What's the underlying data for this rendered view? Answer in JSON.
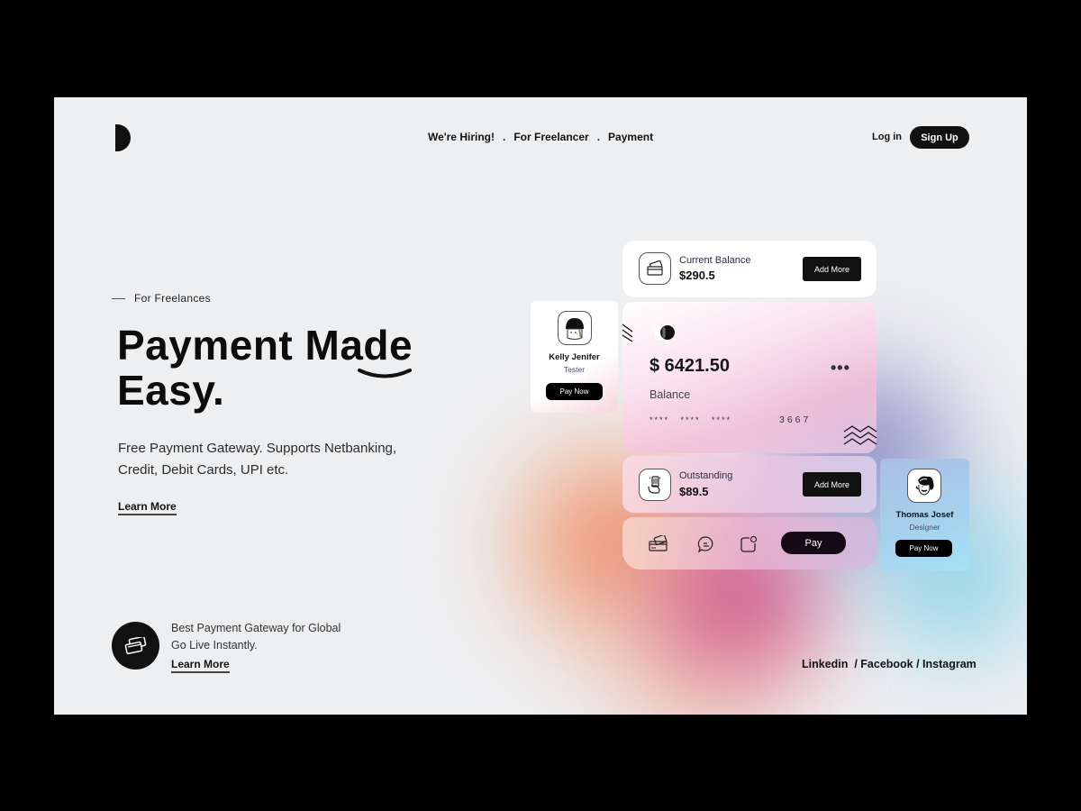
{
  "brand": {
    "logo_icon": "half-circle-logo"
  },
  "nav": {
    "items": [
      {
        "label": "We're Hiring!"
      },
      {
        "label": "For Freelancer"
      },
      {
        "label": "Payment"
      }
    ],
    "separator": ".",
    "login_label": "Log in",
    "signup_label": "Sign Up"
  },
  "hero": {
    "eyebrow": "For Freelances",
    "headline_line1": "Payment Made",
    "headline_line2": "Easy.",
    "description": "Free Payment Gateway. Supports Netbanking, Credit, Debit Cards, UPI etc.",
    "learn_more": "Learn More"
  },
  "promo": {
    "icon": "credit-cards-icon",
    "line1": "Best Payment Gateway for Global",
    "line2": "Go Live Instantly.",
    "learn_more": "Learn More"
  },
  "social": {
    "text": "Linkedin  / Facebook / Instagram"
  },
  "wallet": {
    "current_balance": {
      "label": "Current Balance",
      "value": "$290.5",
      "button": "Add More",
      "icon": "wallet-card-icon"
    },
    "main_card": {
      "amount": "$ 6421.50",
      "label": "Balance",
      "masked": "**** **** ****",
      "last4": "3667",
      "menu": "•••"
    },
    "outstanding": {
      "label": "Outstanding",
      "value": "$89.5",
      "button": "Add More",
      "icon": "hand-card-icon"
    },
    "actions": {
      "icons": [
        "card-icon",
        "chat-icon",
        "notification-icon"
      ],
      "pay_label": "Pay"
    }
  },
  "contacts": [
    {
      "name": "Kelly Jenifer",
      "role": "Tester",
      "button": "Pay Now"
    },
    {
      "name": "Thomas Josef",
      "role": "Designer",
      "button": "Pay Now"
    }
  ],
  "colors": {
    "background": "#eeeff1",
    "dark": "#111111",
    "blob_orange": "#f18a5a",
    "blob_magenta": "#c9447e",
    "blob_purple": "#7d7cc0",
    "blob_cyan": "#7fd0e6"
  }
}
